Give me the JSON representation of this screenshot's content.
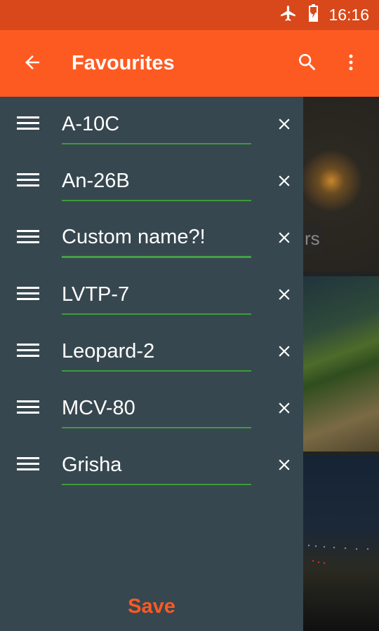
{
  "status_bar": {
    "time": "16:16",
    "icons": [
      "airplane-mode-icon",
      "battery-charging-icon"
    ]
  },
  "app_bar": {
    "title": "Favourites",
    "icons": [
      "back-arrow-icon",
      "search-icon",
      "more-vert-icon"
    ]
  },
  "colors": {
    "status_bar": "#d8481a",
    "app_bar": "#fd5a22",
    "drawer": "#37474f",
    "underline": "#3d9c3a",
    "save_text": "#fd5a22"
  },
  "favourites": [
    {
      "value": "A-10C"
    },
    {
      "value": "An-26B"
    },
    {
      "value": "Custom name?!"
    },
    {
      "value": "LVTP-7"
    },
    {
      "value": "Leopard-2"
    },
    {
      "value": "MCV-80"
    },
    {
      "value": "Grisha"
    }
  ],
  "background": {
    "partial_label": "rs"
  },
  "save_label": "Save"
}
